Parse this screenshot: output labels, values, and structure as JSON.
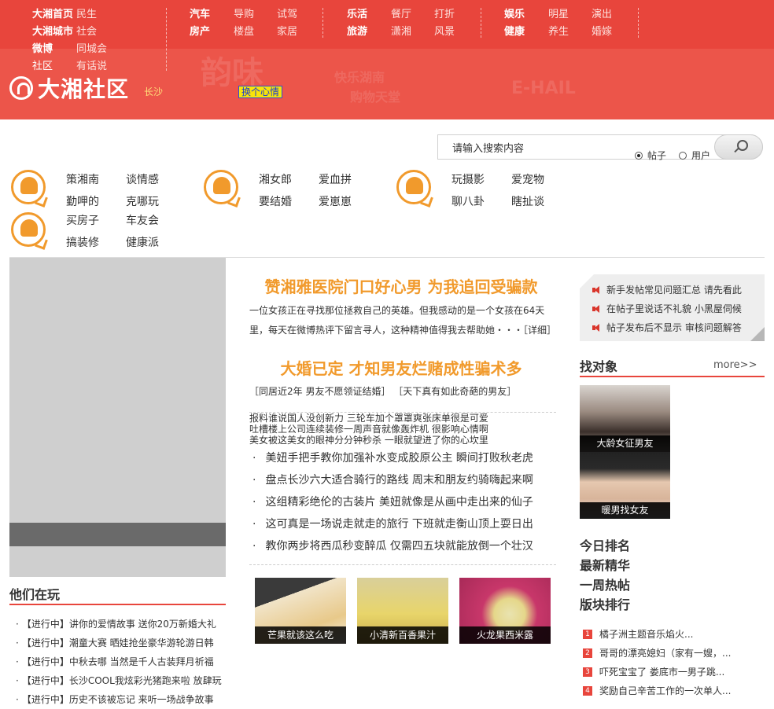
{
  "header": {
    "nav_groups": [
      {
        "rows": [
          {
            "bold": "大湘首页",
            "items": [
              "民生"
            ]
          },
          {
            "bold": "大湘城市",
            "items": [
              "社会"
            ]
          },
          {
            "bold": "微博",
            "items": [
              "同城会"
            ]
          },
          {
            "bold": "社区",
            "items": [
              "有话说"
            ]
          }
        ]
      },
      {
        "rows": [
          {
            "bold": "汽车",
            "items": [
              "导购",
              "试驾"
            ]
          },
          {
            "bold": "房产",
            "items": [
              "楼盘",
              "家居"
            ]
          }
        ]
      },
      {
        "rows": [
          {
            "bold": "乐活",
            "items": [
              "餐厅",
              "打折"
            ]
          },
          {
            "bold": "旅游",
            "items": [
              "潇湘",
              "风景"
            ]
          }
        ]
      },
      {
        "rows": [
          {
            "bold": "娱乐",
            "items": [
              "明星",
              "演出"
            ]
          },
          {
            "bold": "健康",
            "items": [
              "养生",
              "婚嫁"
            ]
          }
        ]
      }
    ],
    "logo_text": "大湘社区",
    "city": "长沙",
    "mood_button": "换个心情",
    "deco_words": [
      "韵味",
      "快乐湖南",
      "购物天堂",
      "E-HAIL"
    ]
  },
  "search": {
    "placeholder": "请输入搜索内容",
    "option_posts": "帖子",
    "option_users": "用户",
    "selected": "帖子"
  },
  "categories": {
    "g1": [
      "策湘南",
      "谈情感",
      "勤呷的",
      "克哪玩"
    ],
    "g2": [
      "湘女郎",
      "爱血拼",
      "要结婚",
      "爱崽崽"
    ],
    "g3": [
      "玩摄影",
      "爱宠物",
      "聊八卦",
      "瞎扯谈"
    ],
    "g4": [
      "买房子",
      "车友会",
      "搞装修",
      "健康派"
    ]
  },
  "left": {
    "section_title": "他们在玩",
    "list": [
      "【进行中】讲你的爱情故事 送你20万新婚大礼",
      "【进行中】潮童大赛 晒娃抢坐豪华游轮游日韩",
      "【进行中】中秋去哪 当然是千人古装拜月祈福",
      "【进行中】长沙COOL我炫彩光猪跑来啦 放肆玩",
      "【进行中】历史不该被忘记 来听一场战争故事"
    ]
  },
  "center": {
    "headline1": "赞湘雅医院门口好心男 为我追回受骗款",
    "paragraph": "一位女孩正在寻找那位拯救自己的英雄。但我感动的是一个女孩在64天里，每天在微博热评下留言寻人，这种精神值得我去帮助她・・・［详细］",
    "headline2": "大婚已定 才知男友烂赌成性骗术多",
    "sublink1": "［同居近2年 男友不愿领证结婚］",
    "sublink2": "［天下真有如此奇葩的男友］",
    "tight_lines": [
      "报料谁说国人没创新力 三轮车加个罩罩爽张床单很是可爱",
      "吐槽楼上公司连续装修一周声音就像轰炸机 很影响心情啊",
      "美女被这美女的眼神分分钟秒杀 一眼就望进了你的心坎里"
    ],
    "bullets": [
      "美妞手把手教你加强补水变成胶原公主 瞬间打败秋老虎",
      "盘点长沙六大适合骑行的路线 周末和朋友约骑嗨起来啊",
      "这组精彩绝伦的古装片 美妞就像是从画中走出来的仙子",
      "这可真是一场说走就走的旅行 下班就走衡山顶上耍日出",
      "教你两步将西瓜秒变醉瓜 仅需四五块就能放倒一个壮汉"
    ],
    "thumbs": [
      {
        "caption": "芒果就该这么吃",
        "color": "#e9d7b8"
      },
      {
        "caption": "小清新百香果汁",
        "color": "#d8c27a"
      },
      {
        "caption": "火龙果西米露",
        "color": "#c43d6b"
      }
    ]
  },
  "right": {
    "notices": [
      "新手发帖常见问题汇总 请先看此",
      "在帖子里说话不礼貌 小黑屋伺候",
      "帖子发布后不显示 审核问题解答"
    ],
    "find_title": "找对象",
    "more_label": "more>>",
    "persons": [
      {
        "caption": "大龄女征男友",
        "color": "#b9aaa0"
      },
      {
        "caption": "暖男找女友",
        "color": "#cfd2d8"
      }
    ],
    "rank_links": [
      "今日排名",
      "最新精华",
      "一周热帖",
      "版块排行"
    ],
    "ranks": [
      {
        "num": "1",
        "text": "橘子洲主题音乐焰火..."
      },
      {
        "num": "2",
        "text": "哥哥的漂亮媳妇（家有一嫂，..."
      },
      {
        "num": "3",
        "text": "吓死宝宝了 娄底市一男子跳..."
      },
      {
        "num": "4",
        "text": "奖励自己辛苦工作的一次单人..."
      }
    ]
  }
}
